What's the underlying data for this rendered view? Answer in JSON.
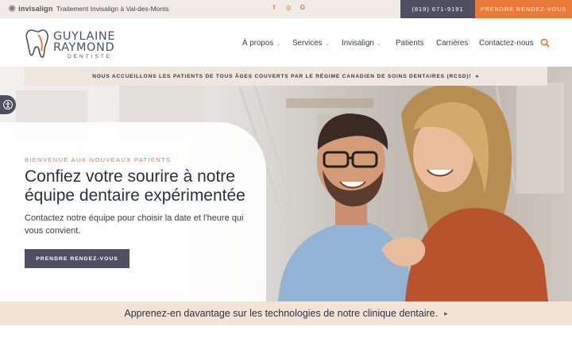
{
  "topbar": {
    "invisalign_logo": "invisalign",
    "tagline": "Traitement Invisalign à Val-des-Monts",
    "social": [
      {
        "icon": "facebook-icon",
        "glyph": "f"
      },
      {
        "icon": "instagram-icon",
        "glyph": "◎"
      },
      {
        "icon": "google-icon",
        "glyph": "G"
      }
    ],
    "phone": "(819) 671-9191",
    "cta": "PRENDRE RENDEZ-VOUS",
    "accent": "#e97a3c",
    "dark": "#4e5061"
  },
  "logo": {
    "line1": "GUYLAINE",
    "line2": "RAYMOND",
    "line3": "DENTISTE"
  },
  "nav": {
    "items": [
      {
        "label": "À propos",
        "dropdown": true
      },
      {
        "label": "Services",
        "dropdown": true
      },
      {
        "label": "Invisalign",
        "dropdown": true
      },
      {
        "label": "Patients",
        "dropdown": false
      },
      {
        "label": "Carrières",
        "dropdown": false
      },
      {
        "label": "Contactez-nous",
        "dropdown": false
      }
    ],
    "search_icon": "search-icon"
  },
  "announcement": "NOUS ACCUEILLONS LES PATIENTS DE TOUS ÂGES COUVERTS PAR LE RÉGIME CANADIEN DE SOINS DENTAIRES (RCSD)!",
  "hero": {
    "kicker": "BIENVENUE AUX NOUVEAUX PATIENTS",
    "headline": "Confiez votre sourire à notre équipe dentaire expérimentée",
    "subtext": "Contactez notre équipe pour choisir la date et l'heure qui vous convient.",
    "button": "PRENDRE RENDEZ-VOUS"
  },
  "tech_strip": "Apprenez-en davantage sur les technologies de notre clinique dentaire."
}
